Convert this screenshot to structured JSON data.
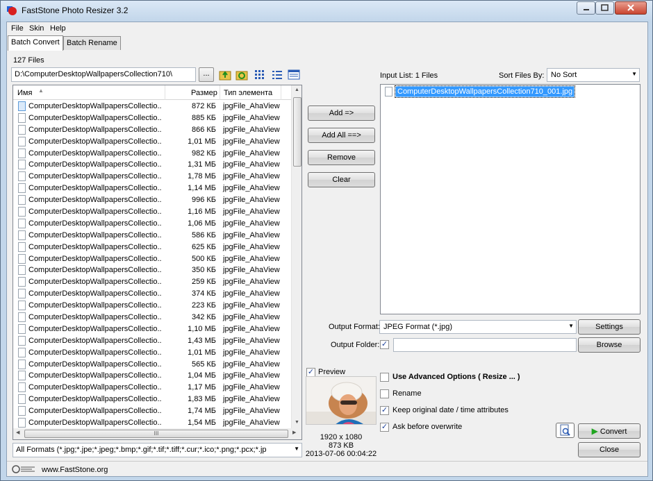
{
  "window": {
    "title": "FastStone Photo Resizer 3.2"
  },
  "menu": [
    "File",
    "Skin",
    "Help"
  ],
  "tabs": [
    "Batch Convert",
    "Batch Rename"
  ],
  "file_count": "127 Files",
  "path": "D:\\ComputerDesktopWallpapersCollection710\\",
  "browse_label": "...",
  "columns": {
    "name": "Имя",
    "size": "Размер",
    "type": "Тип элемента"
  },
  "files": [
    {
      "name": "ComputerDesktopWallpapersCollectio...",
      "size": "872 КБ",
      "type": "jpgFile_AhaView"
    },
    {
      "name": "ComputerDesktopWallpapersCollectio...",
      "size": "885 КБ",
      "type": "jpgFile_AhaView"
    },
    {
      "name": "ComputerDesktopWallpapersCollectio...",
      "size": "866 КБ",
      "type": "jpgFile_AhaView"
    },
    {
      "name": "ComputerDesktopWallpapersCollectio...",
      "size": "1,01 МБ",
      "type": "jpgFile_AhaView"
    },
    {
      "name": "ComputerDesktopWallpapersCollectio...",
      "size": "982 КБ",
      "type": "jpgFile_AhaView"
    },
    {
      "name": "ComputerDesktopWallpapersCollectio...",
      "size": "1,31 МБ",
      "type": "jpgFile_AhaView"
    },
    {
      "name": "ComputerDesktopWallpapersCollectio...",
      "size": "1,78 МБ",
      "type": "jpgFile_AhaView"
    },
    {
      "name": "ComputerDesktopWallpapersCollectio...",
      "size": "1,14 МБ",
      "type": "jpgFile_AhaView"
    },
    {
      "name": "ComputerDesktopWallpapersCollectio...",
      "size": "996 КБ",
      "type": "jpgFile_AhaView"
    },
    {
      "name": "ComputerDesktopWallpapersCollectio...",
      "size": "1,16 МБ",
      "type": "jpgFile_AhaView"
    },
    {
      "name": "ComputerDesktopWallpapersCollectio...",
      "size": "1,06 МБ",
      "type": "jpgFile_AhaView"
    },
    {
      "name": "ComputerDesktopWallpapersCollectio...",
      "size": "586 КБ",
      "type": "jpgFile_AhaView"
    },
    {
      "name": "ComputerDesktopWallpapersCollectio...",
      "size": "625 КБ",
      "type": "jpgFile_AhaView"
    },
    {
      "name": "ComputerDesktopWallpapersCollectio...",
      "size": "500 КБ",
      "type": "jpgFile_AhaView"
    },
    {
      "name": "ComputerDesktopWallpapersCollectio...",
      "size": "350 КБ",
      "type": "jpgFile_AhaView"
    },
    {
      "name": "ComputerDesktopWallpapersCollectio...",
      "size": "259 КБ",
      "type": "jpgFile_AhaView"
    },
    {
      "name": "ComputerDesktopWallpapersCollectio...",
      "size": "374 КБ",
      "type": "jpgFile_AhaView"
    },
    {
      "name": "ComputerDesktopWallpapersCollectio...",
      "size": "223 КБ",
      "type": "jpgFile_AhaView"
    },
    {
      "name": "ComputerDesktopWallpapersCollectio...",
      "size": "342 КБ",
      "type": "jpgFile_AhaView"
    },
    {
      "name": "ComputerDesktopWallpapersCollectio...",
      "size": "1,10 МБ",
      "type": "jpgFile_AhaView"
    },
    {
      "name": "ComputerDesktopWallpapersCollectio...",
      "size": "1,43 МБ",
      "type": "jpgFile_AhaView"
    },
    {
      "name": "ComputerDesktopWallpapersCollectio...",
      "size": "1,01 МБ",
      "type": "jpgFile_AhaView"
    },
    {
      "name": "ComputerDesktopWallpapersCollectio...",
      "size": "565 КБ",
      "type": "jpgFile_AhaView"
    },
    {
      "name": "ComputerDesktopWallpapersCollectio...",
      "size": "1,04 МБ",
      "type": "jpgFile_AhaView"
    },
    {
      "name": "ComputerDesktopWallpapersCollectio...",
      "size": "1,17 МБ",
      "type": "jpgFile_AhaView"
    },
    {
      "name": "ComputerDesktopWallpapersCollectio...",
      "size": "1,83 МБ",
      "type": "jpgFile_AhaView"
    },
    {
      "name": "ComputerDesktopWallpapersCollectio...",
      "size": "1,74 МБ",
      "type": "jpgFile_AhaView"
    },
    {
      "name": "ComputerDesktopWallpapersCollectio...",
      "size": "1,54 МБ",
      "type": "jpgFile_AhaView"
    }
  ],
  "scroll_thumb_label": "III",
  "format_filter": "All Formats (*.jpg;*.jpe;*.jpeg;*.bmp;*.gif;*.tif;*.tiff;*.cur;*.ico;*.png;*.pcx;*.jp",
  "buttons": {
    "add": "Add =>",
    "add_all": "Add All ==>",
    "remove": "Remove",
    "clear": "Clear",
    "settings": "Settings",
    "browse": "Browse",
    "convert": "Convert",
    "close": "Close"
  },
  "input_list": {
    "label": "Input List:  1 Files",
    "sort_label": "Sort Files By:",
    "sort_value": "No Sort",
    "items": [
      "ComputerDesktopWallpapersCollection710_001.jpg"
    ]
  },
  "output": {
    "format_label": "Output Format:",
    "format_value": "JPEG Format (*.jpg)",
    "folder_label": "Output Folder:",
    "folder_checked": true
  },
  "preview": {
    "label": "Preview",
    "checked": true,
    "dimensions": "1920 x 1080",
    "size": "873 KB",
    "date": "2013-07-06 00:04:22"
  },
  "options": [
    {
      "label": "Use Advanced Options ( Resize ... )",
      "checked": false,
      "bold": true
    },
    {
      "label": "Rename",
      "checked": false,
      "bold": false
    },
    {
      "label": "Keep original date / time attributes",
      "checked": true,
      "bold": false
    },
    {
      "label": "Ask before overwrite",
      "checked": true,
      "bold": false
    }
  ],
  "status": {
    "website": "www.FastStone.org"
  },
  "colors": {
    "selection": "#3399ff",
    "convert_arrow": "#1fa51f",
    "title_bg": "#c2d6ea"
  }
}
